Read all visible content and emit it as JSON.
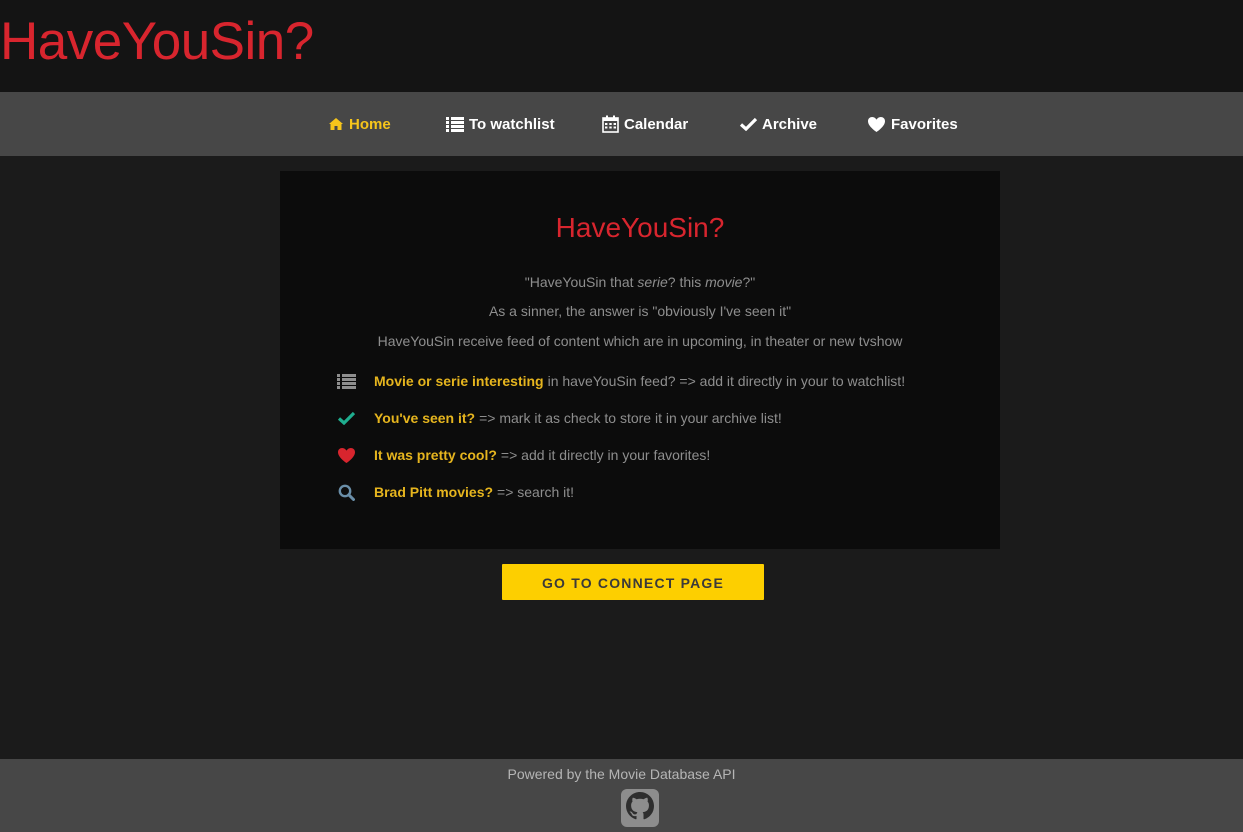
{
  "header": {
    "app_title": "HaveYouSin?"
  },
  "nav": {
    "items": [
      {
        "label": "Home",
        "icon": "home-icon",
        "active": true
      },
      {
        "label": "To watchlist",
        "icon": "list-icon",
        "active": false
      },
      {
        "label": "Calendar",
        "icon": "calendar-icon",
        "active": false
      },
      {
        "label": "Archive",
        "icon": "check-icon",
        "active": false
      },
      {
        "label": "Favorites",
        "icon": "heart-icon",
        "active": false
      }
    ]
  },
  "panel": {
    "title": "HaveYouSin?",
    "intro": {
      "line1_before": "\"HaveYouSin that ",
      "line1_em1": "serie",
      "line1_mid": "? this ",
      "line1_em2": "movie",
      "line1_after": "?\"",
      "line2": "As a sinner, the answer is \"obviously I've seen it\"",
      "line3": "HaveYouSin receive feed of content which are in upcoming, in theater or new tvshow"
    },
    "features": [
      {
        "icon": "list-icon",
        "highlight": "Movie or serie interesting",
        "text": "in haveYouSin feed? => add it directly in your to watchlist!"
      },
      {
        "icon": "check-icon",
        "highlight": "You've seen it?",
        "text": "=> mark it as check to store it in your archive list!"
      },
      {
        "icon": "heart-icon",
        "highlight": "It was pretty cool?",
        "text": "=> add it directly in your favorites!"
      },
      {
        "icon": "search-icon",
        "highlight": "Brad Pitt movies?",
        "text": "=> search it!"
      }
    ]
  },
  "connect_button": {
    "label": "GO TO CONNECT PAGE"
  },
  "footer": {
    "text": "Powered by the Movie Database API",
    "icon": "github-icon"
  },
  "colors": {
    "brand_red": "#d8252e",
    "accent_yellow": "#fdcf00",
    "highlight_yellow": "#e6b51e",
    "check_teal": "#1fae8f",
    "search_blue": "#6a8ea8"
  }
}
